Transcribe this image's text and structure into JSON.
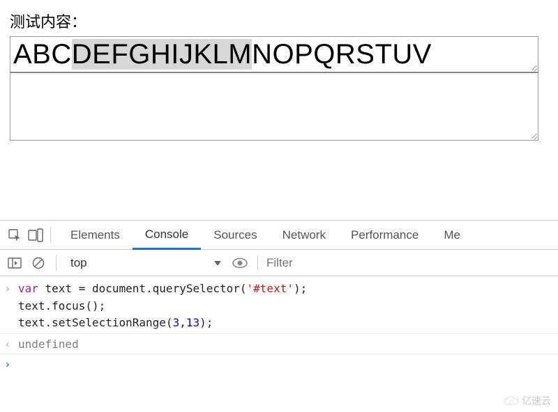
{
  "page": {
    "label": "测试内容：",
    "textarea1_pre": "ABC",
    "textarea1_sel": "DEFGHIJKLM",
    "textarea1_post": "NOPQRSTUV",
    "textarea2_value": ""
  },
  "devtools": {
    "tabs": {
      "elements": "Elements",
      "console": "Console",
      "sources": "Sources",
      "network": "Network",
      "performance": "Performance",
      "memory_partial": "Me"
    },
    "context": "top",
    "filter_placeholder": "Filter",
    "console": {
      "line1_kw": "var",
      "line1_rest": " text = document.querySelector(",
      "line1_str": "'#text'",
      "line1_end": ");",
      "line2": "text.focus();",
      "line3_a": "text.setSelectionRange(",
      "line3_n1": "3",
      "line3_c": ",",
      "line3_n2": "13",
      "line3_b": ");",
      "result": "undefined"
    }
  },
  "watermark": "亿速云"
}
